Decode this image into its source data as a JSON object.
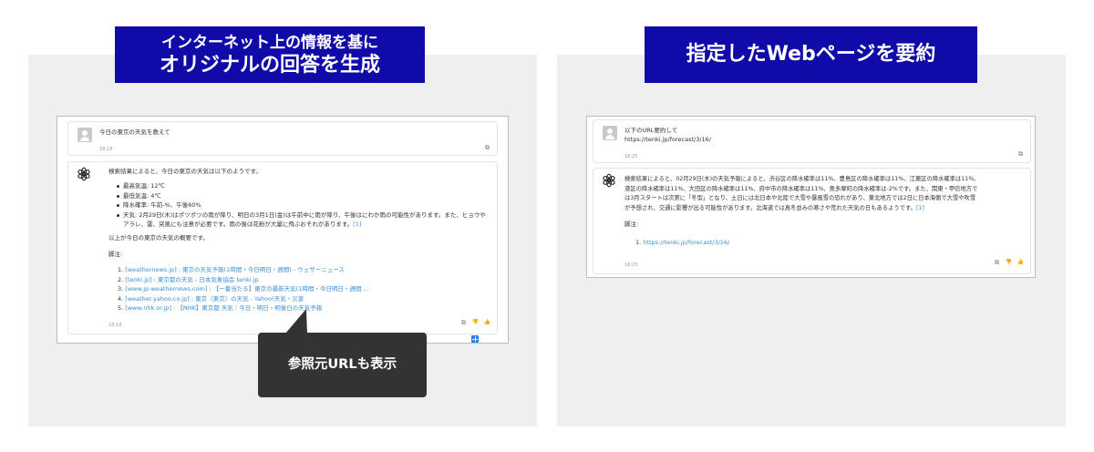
{
  "left_banner": {
    "line1": "インターネット上の情報を基に",
    "line2": "オリジナルの回答を生成"
  },
  "right_banner": {
    "title": "指定したWebページを要約"
  },
  "callout": {
    "label": "参照元URLも表示"
  },
  "left_chat": {
    "user": {
      "text": "今日の東京の天気を教えて",
      "time": "18:18"
    },
    "ai": {
      "intro": "検索結果によると、今日の東京の天気は以下のようです。",
      "bullets": [
        "最高気温: 12℃",
        "最低気温: 4℃",
        "降水確率: 午前-%、午後60%",
        "天気: 2月29日(木)はポツポツの雨が降り、明日の3月1日(金)は午前中に雨が降り、午後はにわか雨の可能性があります。また、ヒョウやアラレ、雷、突風にも注意が必要です。雨の後は花粉が大量に飛ぶおそれがあります。"
      ],
      "bullet_ref": "[1]",
      "summary": "以上が今日の東京の天気の概要です。",
      "footnote_label": "脚注:",
      "footnotes": [
        {
          "num": "1.",
          "text": "[weathernews.jp] : 東京の天気予報(1時間・今日明日・週間) - ウェザーニュース"
        },
        {
          "num": "2.",
          "text": "[tenki.jp] : 東京都の天気 - 日本気象協会 tenki.jp"
        },
        {
          "num": "3.",
          "text": "[www.jp-weathernews.com] : 【一番当たる】東京の最新天気(1時間・今日明日・週間 ..."
        },
        {
          "num": "4.",
          "text": "[weather.yahoo.co.jp] : 東京（東京）の天気 - Yahoo!天気・災害"
        },
        {
          "num": "5.",
          "text": "[www.nhk.or.jp] : 【NHK】東京都 天気｜今日・明日・明後日の天気予報"
        }
      ],
      "time": "18:18"
    }
  },
  "right_chat": {
    "user": {
      "line1": "以下のURL要約して",
      "line2": "https://tenki.jp/forecast/3/16/",
      "time": "18:25"
    },
    "ai": {
      "lines": [
        "検索結果によると、02月29日(木)の天気予報によると、渋谷区の降水確率は11%、豊島区の降水確率は11%、江東区の降水確率は11%、",
        "港区の降水確率は11%、大田区の降水確率は11%、府中市の降水確率は11%、奥多摩町の降水確率は-2%です。また、関東・甲信地方で",
        "は3月スタートは次第に「冬型」となり、土日には北日本や北陸で大雪や暴風雪の恐れがあり、東北地方では2日に日本海側で大雪や吹雪",
        "が予想され、交通に影響が出る可能性があります。北海道では真冬並みの寒さや荒れた天気の日もあるようです。"
      ],
      "ref": "[1]",
      "footnote_label": "脚注:",
      "footnote_num": "1.",
      "footnote_link": "https://tenki.jp/forecast/3/16/",
      "time": "18:25"
    }
  },
  "icons": {
    "copy": "⧉",
    "dislike": "👎",
    "like": "👍"
  }
}
